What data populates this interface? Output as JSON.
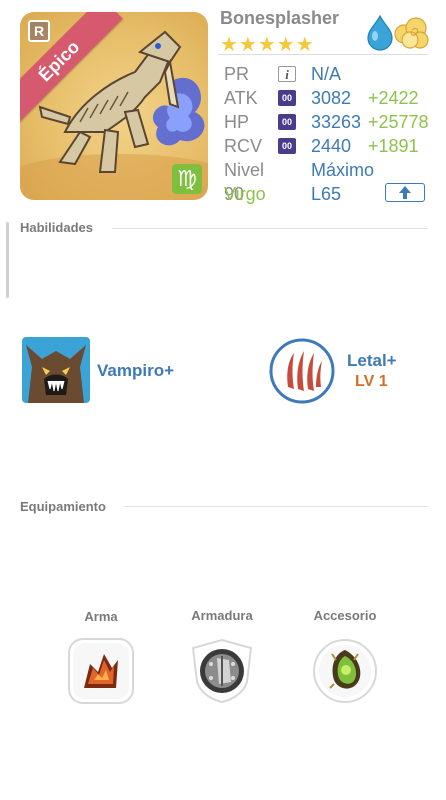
{
  "hero": {
    "name": "Bonesplasher",
    "rarity_label": "Épico",
    "rarity_badge": "R",
    "zodiac_symbol": "♍",
    "stars": "★★★★★",
    "star_count": 5,
    "elements": [
      "water-drop-icon",
      "cloud-icon"
    ]
  },
  "stats": {
    "pr_label": "PR",
    "pr_value": "N/A",
    "pr_icon": "i",
    "atk_label": "ATK",
    "atk_icon": "00",
    "atk_value": "3082",
    "atk_bonus": "+2422",
    "hp_label": "HP",
    "hp_icon": "00",
    "hp_value": "33263",
    "hp_bonus": "+25778",
    "rcv_label": "RCV",
    "rcv_icon": "00",
    "rcv_value": "2440",
    "rcv_bonus": "+1891",
    "level_label": "Nivel 90",
    "level_value": "Máximo",
    "sign_label": "Virgo",
    "sign_value": "L65"
  },
  "skills": {
    "title": "Habilidades",
    "items": [
      {
        "name": "Vampiro+",
        "level": ""
      },
      {
        "name": "Letal+",
        "level": "LV 1"
      }
    ]
  },
  "equipment": {
    "title": "Equipamiento",
    "slots": [
      {
        "label": "Arma"
      },
      {
        "label": "Armadura"
      },
      {
        "label": "Accesorio"
      }
    ]
  },
  "colors": {
    "accent_blue": "#3d7ab7",
    "bonus_green": "#8fc24b",
    "level_orange": "#d2702a",
    "epic_ribbon": "#d65a6e",
    "zodiac_green": "#7ec03e"
  }
}
